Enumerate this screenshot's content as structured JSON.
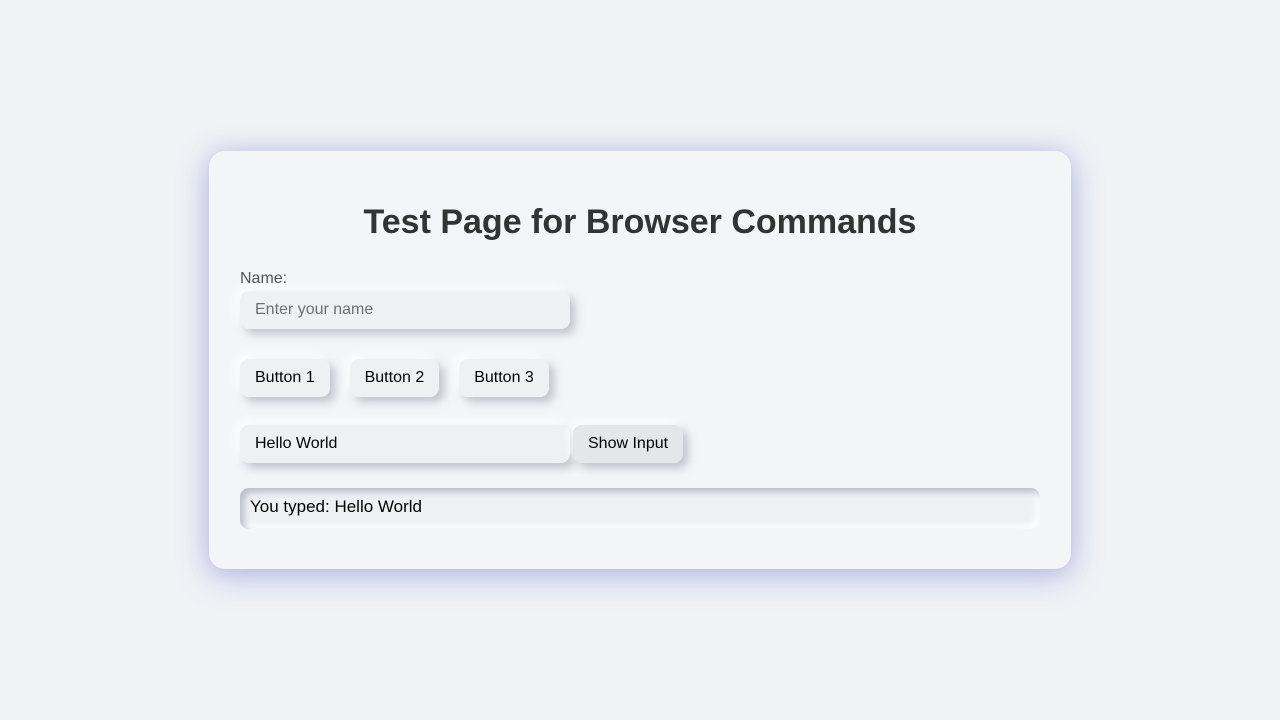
{
  "page": {
    "title": "Test Page for Browser Commands"
  },
  "form": {
    "name_label": "Name:",
    "name_placeholder": "Enter your name",
    "name_value": ""
  },
  "buttons": {
    "button1": "Button 1",
    "button2": "Button 2",
    "button3": "Button 3"
  },
  "echo": {
    "input_value": "Hello World",
    "show_button": "Show Input",
    "output_text": "You typed: Hello World"
  },
  "colors": {
    "background": "#f0f2f6",
    "card": "#f4f5f8",
    "title_text": "#333333",
    "label_text": "#555555"
  }
}
